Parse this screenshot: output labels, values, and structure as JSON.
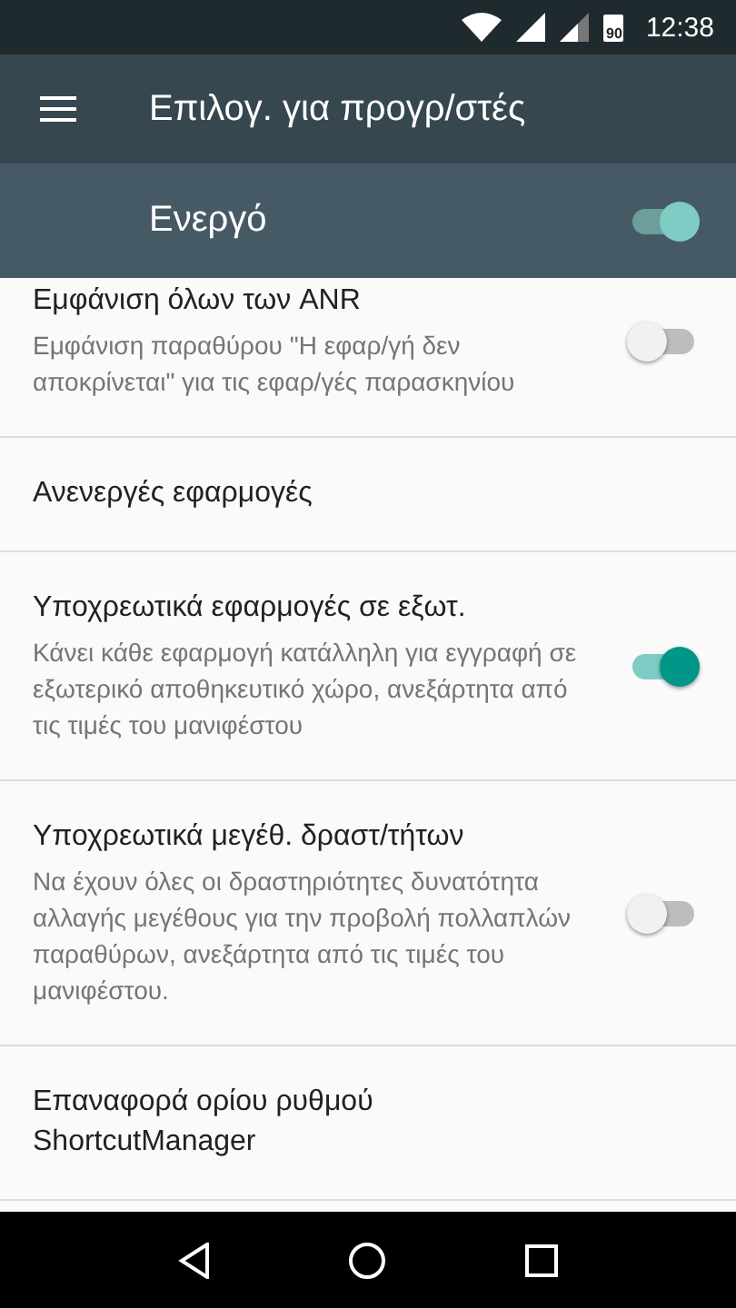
{
  "status_bar": {
    "time": "12:38",
    "battery": "90"
  },
  "toolbar": {
    "title": "Επιλογ. για προγρ/στές"
  },
  "master_switch": {
    "label": "Ενεργό",
    "on": true
  },
  "settings": [
    {
      "kind": "switch",
      "title": "Εμφάνιση όλων των ANR",
      "summary": "Εμφάνιση παραθύρου \"Η εφαρ/γή δεν αποκρίνεται\" για τις εφαρ/γές παρασκηνίου",
      "on": false
    },
    {
      "kind": "plain",
      "title": "Ανενεργές εφαρμογές"
    },
    {
      "kind": "switch",
      "title": "Υποχρεωτικά εφαρμογές σε εξωτ.",
      "summary": "Κάνει κάθε εφαρμογή κατάλληλη για εγγραφή σε εξωτερικό αποθηκευτικό χώρο, ανεξάρτητα από τις τιμές του μανιφέστου",
      "on": true
    },
    {
      "kind": "switch",
      "title": "Υποχρεωτικά μεγέθ. δραστ/τήτων",
      "summary": "Να έχουν όλες οι δραστηριότητες δυνατότητα αλλαγής μεγέθους για την προβολή πολλαπλών παραθύρων, ανεξάρτητα από τις τιμές του μανιφέστου.",
      "on": false
    },
    {
      "kind": "plain",
      "title": "Επαναφορά ορίου ρυθμού ShortcutManager"
    }
  ]
}
